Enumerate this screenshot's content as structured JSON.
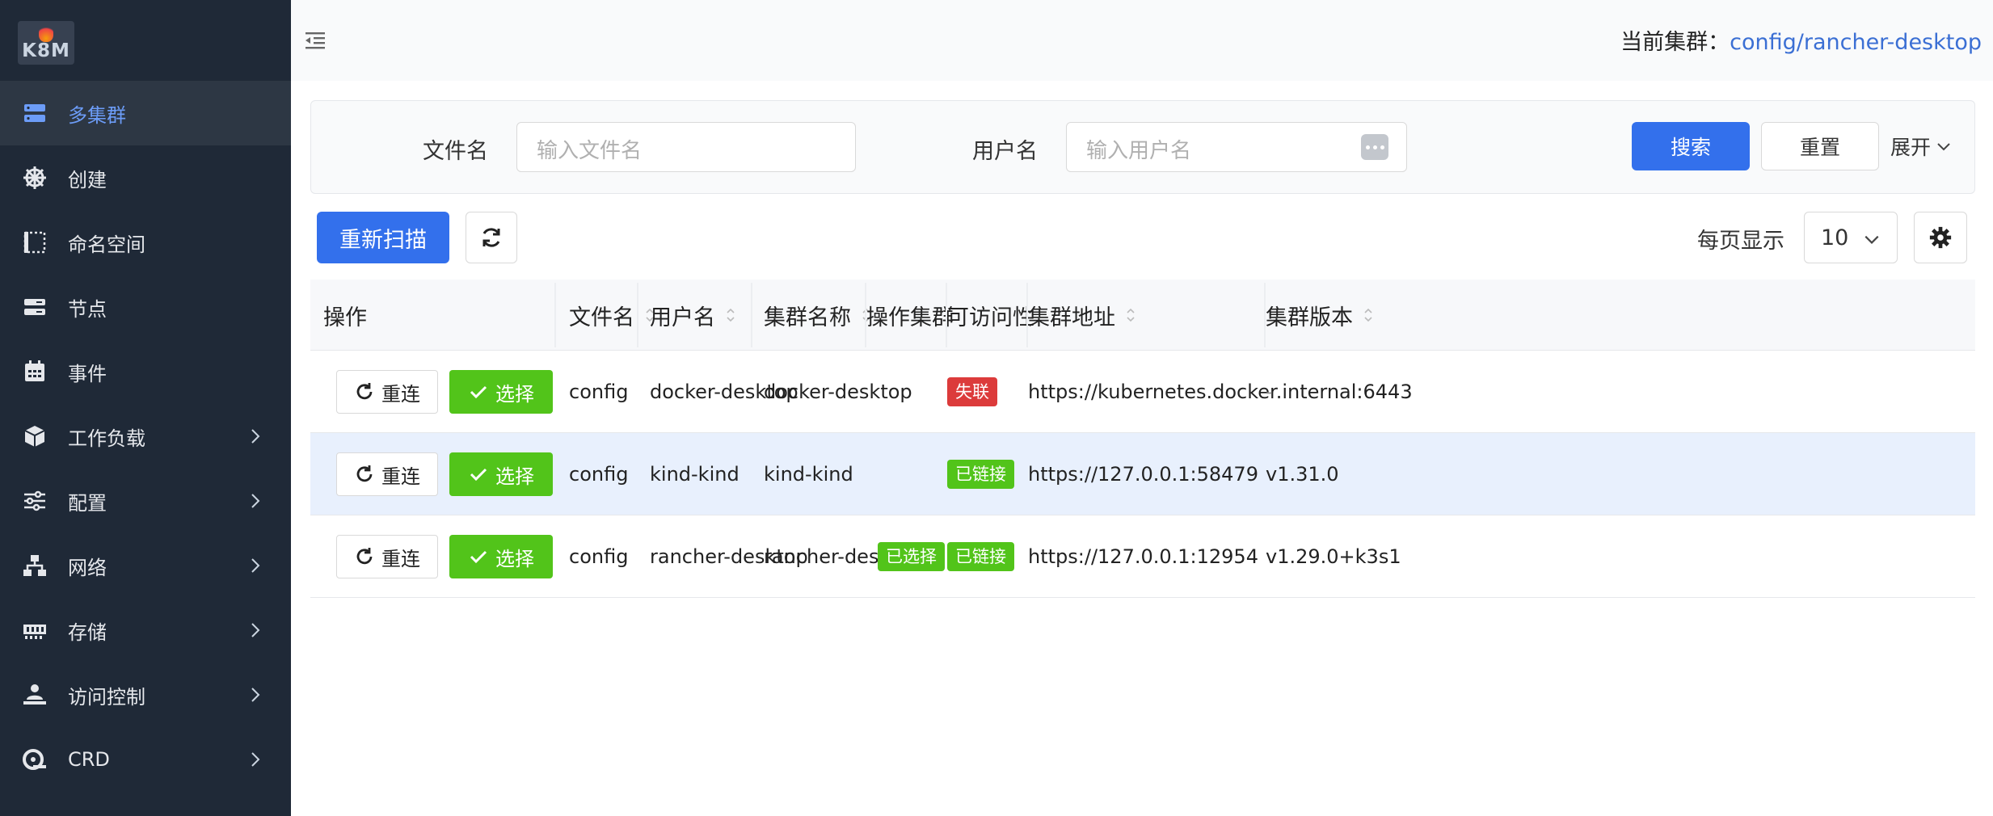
{
  "app": {
    "logo_text": "K8M"
  },
  "sidebar": {
    "items": [
      {
        "label": "多集群",
        "icon": "server-stack-icon",
        "active": true,
        "has_children": false
      },
      {
        "label": "创建",
        "icon": "helm-wheel-icon",
        "active": false,
        "has_children": false
      },
      {
        "label": "命名空间",
        "icon": "namespace-frame-icon",
        "active": false,
        "has_children": false
      },
      {
        "label": "节点",
        "icon": "server-node-icon",
        "active": false,
        "has_children": false
      },
      {
        "label": "事件",
        "icon": "calendar-icon",
        "active": false,
        "has_children": false
      },
      {
        "label": "工作负载",
        "icon": "cube-icon",
        "active": false,
        "has_children": true
      },
      {
        "label": "配置",
        "icon": "sliders-icon",
        "active": false,
        "has_children": true
      },
      {
        "label": "网络",
        "icon": "network-icon",
        "active": false,
        "has_children": true
      },
      {
        "label": "存储",
        "icon": "memory-icon",
        "active": false,
        "has_children": true
      },
      {
        "label": "访问控制",
        "icon": "user-access-icon",
        "active": false,
        "has_children": true
      },
      {
        "label": "CRD",
        "icon": "crd-icon",
        "active": false,
        "has_children": true
      }
    ]
  },
  "header": {
    "cluster_label": "当前集群：",
    "cluster_value": "config/rancher-desktop"
  },
  "search": {
    "filename_label": "文件名",
    "filename_placeholder": "输入文件名",
    "username_label": "用户名",
    "username_placeholder": "输入用户名",
    "search_button": "搜索",
    "reset_button": "重置",
    "expand_label": "展开"
  },
  "toolbar": {
    "rescan_button": "重新扫描",
    "per_page_label": "每页显示",
    "per_page_value": "10"
  },
  "table": {
    "columns": [
      "操作",
      "文件名",
      "用户名",
      "集群名称",
      "操作集群",
      "可访问性",
      "集群地址",
      "集群版本"
    ],
    "reconnect_label": "重连",
    "select_label": "选择",
    "rows": [
      {
        "file": "config",
        "user": "docker-desktop",
        "cluster": "docker-desktop",
        "selected": "",
        "access": "失联",
        "access_status": "disconnected",
        "address": "https://kubernetes.docker.internal:6443",
        "version": "-",
        "highlight": false
      },
      {
        "file": "config",
        "user": "kind-kind",
        "cluster": "kind-kind",
        "selected": "",
        "access": "已链接",
        "access_status": "connected",
        "address": "https://127.0.0.1:58479",
        "version": "v1.31.0",
        "highlight": true
      },
      {
        "file": "config",
        "user": "rancher-desktop",
        "cluster": "rancher-desktop",
        "selected": "已选择",
        "access": "已链接",
        "access_status": "connected",
        "address": "https://127.0.0.1:12954",
        "version": "v1.29.0+k3s1",
        "highlight": false
      }
    ]
  },
  "colors": {
    "sidebar_bg": "#1f2937",
    "primary": "#3370ec",
    "success": "#52c41a",
    "danger": "#dc3b3b",
    "link": "#3b6fd4"
  }
}
